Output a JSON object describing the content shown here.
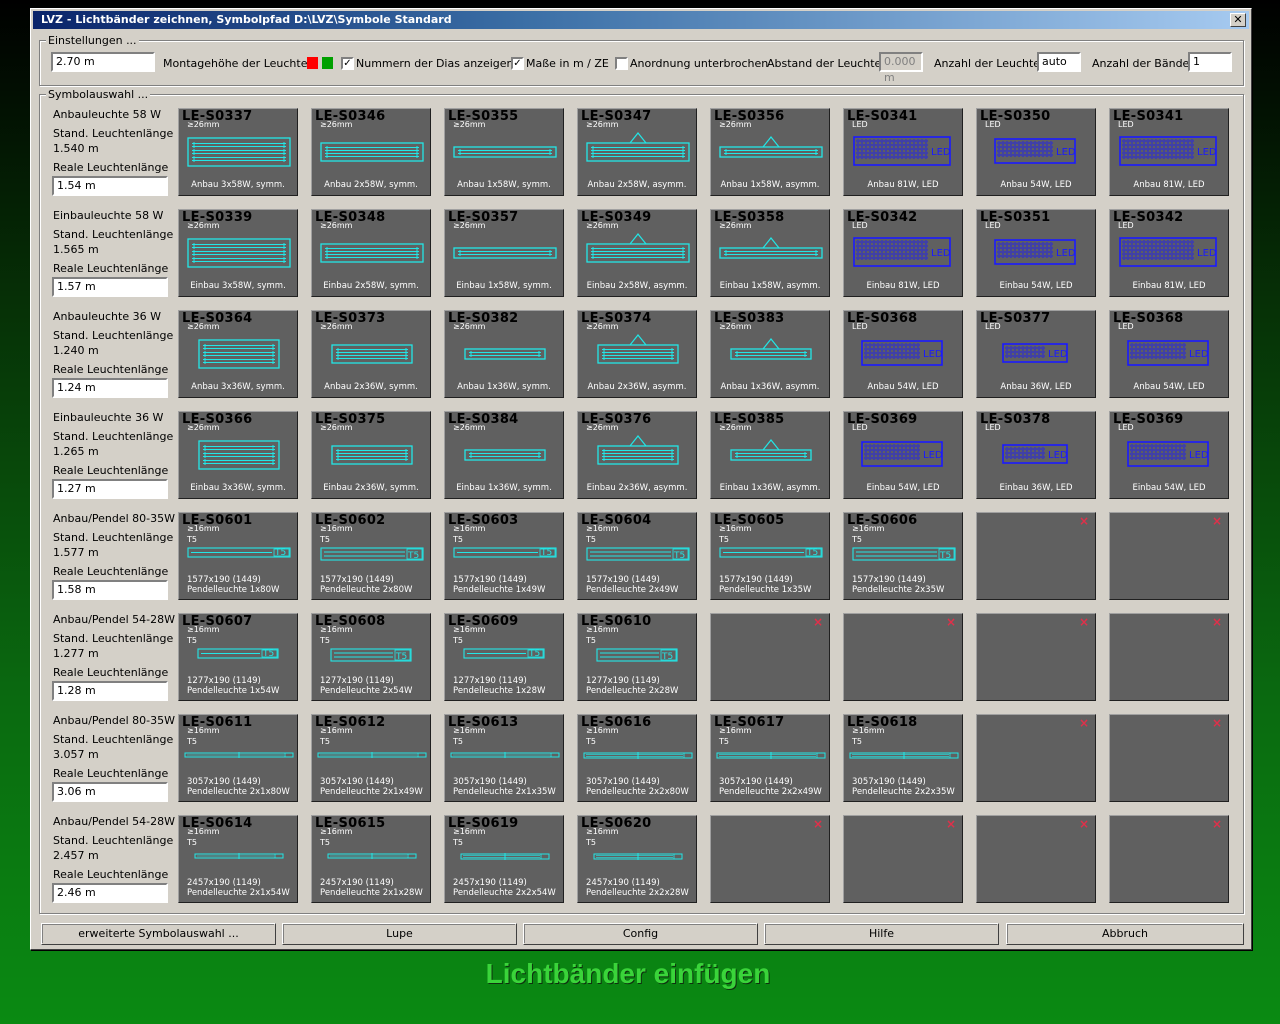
{
  "window": {
    "title": "LVZ - Lichtbänder zeichnen, Symbolpfad D:\\LVZ\\Symbole Standard",
    "close": "✕"
  },
  "settings": {
    "legend": "Einstellungen ...",
    "height_value": "2.70 m",
    "height_label": "Montagehöhe der Leuchten",
    "swatch_colors": [
      "#ff0000",
      "#00a000"
    ],
    "show_numbers_label": "Nummern der Dias anzeigen",
    "show_numbers_checked": "✓",
    "units_label": "Maße in m / ZE",
    "units_checked": "✓",
    "interrupted_label": "Anordnung unterbrochen",
    "interrupted_checked": "",
    "distance_label": "Abstand der Leuchten",
    "distance_value": "0.000 m",
    "count_label": "Anzahl der Leuchten",
    "count_value": "auto",
    "bands_label": "Anzahl der Bänder",
    "bands_value": "1"
  },
  "symbols": {
    "legend": "Symbolauswahl ...",
    "rows": [
      {
        "type": "Anbauleuchte 58 W",
        "std_label": "Stand. Leuchtenlänge",
        "std": "1.540 m",
        "real_label": "Reale Leuchtenlänge",
        "real": "1.54 m",
        "tiles": [
          {
            "code": "LE-S0337",
            "kind": "box",
            "lines": 3,
            "tri": false,
            "sub1": "≥26mm",
            "cap": "Anbau 3x58W, symm."
          },
          {
            "code": "LE-S0346",
            "kind": "box",
            "lines": 2,
            "tri": false,
            "sub1": "≥26mm",
            "cap": "Anbau 2x58W, symm."
          },
          {
            "code": "LE-S0355",
            "kind": "box",
            "lines": 1,
            "tri": false,
            "sub1": "≥26mm",
            "cap": "Anbau 1x58W, symm."
          },
          {
            "code": "LE-S0347",
            "kind": "box",
            "lines": 2,
            "tri": true,
            "sub1": "≥26mm",
            "cap": "Anbau 2x58W, asymm."
          },
          {
            "code": "LE-S0356",
            "kind": "box",
            "lines": 1,
            "tri": true,
            "sub1": "≥26mm",
            "cap": "Anbau 1x58W, asymm."
          },
          {
            "code": "LE-S0341",
            "kind": "led",
            "size": "l",
            "sub1": "LED",
            "cap": "Anbau 81W, LED"
          },
          {
            "code": "LE-S0350",
            "kind": "led",
            "size": "m",
            "sub1": "LED",
            "cap": "Anbau 54W, LED"
          },
          {
            "code": "LE-S0341",
            "kind": "led",
            "size": "l",
            "sub1": "LED",
            "cap": "Anbau 81W, LED"
          }
        ]
      },
      {
        "type": "Einbauleuchte 58 W",
        "std_label": "Stand. Leuchtenlänge",
        "std": "1.565 m",
        "real_label": "Reale Leuchtenlänge",
        "real": "1.57 m",
        "tiles": [
          {
            "code": "LE-S0339",
            "kind": "box",
            "lines": 3,
            "tri": false,
            "sub1": "≥26mm",
            "cap": "Einbau 3x58W, symm."
          },
          {
            "code": "LE-S0348",
            "kind": "box",
            "lines": 2,
            "tri": false,
            "sub1": "≥26mm",
            "cap": "Einbau 2x58W, symm."
          },
          {
            "code": "LE-S0357",
            "kind": "box",
            "lines": 1,
            "tri": false,
            "sub1": "≥26mm",
            "cap": "Einbau 1x58W, symm."
          },
          {
            "code": "LE-S0349",
            "kind": "box",
            "lines": 2,
            "tri": true,
            "sub1": "≥26mm",
            "cap": "Einbau 2x58W, asymm."
          },
          {
            "code": "LE-S0358",
            "kind": "box",
            "lines": 1,
            "tri": true,
            "sub1": "≥26mm",
            "cap": "Einbau 1x58W, asymm."
          },
          {
            "code": "LE-S0342",
            "kind": "led",
            "size": "l",
            "sub1": "LED",
            "cap": "Einbau 81W, LED"
          },
          {
            "code": "LE-S0351",
            "kind": "led",
            "size": "m",
            "sub1": "LED",
            "cap": "Einbau 54W, LED"
          },
          {
            "code": "LE-S0342",
            "kind": "led",
            "size": "l",
            "sub1": "LED",
            "cap": "Einbau 81W, LED"
          }
        ]
      },
      {
        "type": "Anbauleuchte 36 W",
        "std_label": "Stand. Leuchtenlänge",
        "std": "1.240 m",
        "real_label": "Reale Leuchtenlänge",
        "real": "1.24 m",
        "tiles": [
          {
            "code": "LE-S0364",
            "kind": "box",
            "lines": 3,
            "tri": false,
            "short": true,
            "sub1": "≥26mm",
            "cap": "Anbau 3x36W, symm."
          },
          {
            "code": "LE-S0373",
            "kind": "box",
            "lines": 2,
            "tri": false,
            "short": true,
            "sub1": "≥26mm",
            "cap": "Anbau 2x36W, symm."
          },
          {
            "code": "LE-S0382",
            "kind": "box",
            "lines": 1,
            "tri": false,
            "short": true,
            "sub1": "≥26mm",
            "cap": "Anbau 1x36W, symm."
          },
          {
            "code": "LE-S0374",
            "kind": "box",
            "lines": 2,
            "tri": true,
            "short": true,
            "sub1": "≥26mm",
            "cap": "Anbau 2x36W, asymm."
          },
          {
            "code": "LE-S0383",
            "kind": "box",
            "lines": 1,
            "tri": true,
            "short": true,
            "sub1": "≥26mm",
            "cap": "Anbau 1x36W, asymm."
          },
          {
            "code": "LE-S0368",
            "kind": "led",
            "size": "m",
            "sub1": "LED",
            "cap": "Anbau 54W, LED"
          },
          {
            "code": "LE-S0377",
            "kind": "led",
            "size": "s",
            "sub1": "LED",
            "cap": "Anbau 36W, LED"
          },
          {
            "code": "LE-S0368",
            "kind": "led",
            "size": "m",
            "sub1": "LED",
            "cap": "Anbau 54W, LED"
          }
        ]
      },
      {
        "type": "Einbauleuchte 36 W",
        "std_label": "Stand. Leuchtenlänge",
        "std": "1.265 m",
        "real_label": "Reale Leuchtenlänge",
        "real": "1.27 m",
        "tiles": [
          {
            "code": "LE-S0366",
            "kind": "box",
            "lines": 3,
            "tri": false,
            "short": true,
            "sub1": "≥26mm",
            "cap": "Einbau 3x36W, symm."
          },
          {
            "code": "LE-S0375",
            "kind": "box",
            "lines": 2,
            "tri": false,
            "short": true,
            "sub1": "≥26mm",
            "cap": "Einbau 2x36W, symm."
          },
          {
            "code": "LE-S0384",
            "kind": "box",
            "lines": 1,
            "tri": false,
            "short": true,
            "sub1": "≥26mm",
            "cap": "Einbau 1x36W, symm."
          },
          {
            "code": "LE-S0376",
            "kind": "box",
            "lines": 2,
            "tri": true,
            "short": true,
            "sub1": "≥26mm",
            "cap": "Einbau 2x36W, asymm."
          },
          {
            "code": "LE-S0385",
            "kind": "box",
            "lines": 1,
            "tri": true,
            "short": true,
            "sub1": "≥26mm",
            "cap": "Einbau 1x36W, asymm."
          },
          {
            "code": "LE-S0369",
            "kind": "led",
            "size": "m",
            "sub1": "LED",
            "cap": "Einbau 54W, LED"
          },
          {
            "code": "LE-S0378",
            "kind": "led",
            "size": "s",
            "sub1": "LED",
            "cap": "Einbau 36W, LED"
          },
          {
            "code": "LE-S0369",
            "kind": "led",
            "size": "m",
            "sub1": "LED",
            "cap": "Einbau 54W, LED"
          }
        ]
      },
      {
        "type": "Anbau/Pendel 80-35W",
        "std_label": "Stand. Leuchtenlänge",
        "std": "1.577 m",
        "real_label": "Reale Leuchtenlänge",
        "real": "1.58 m",
        "tiles": [
          {
            "code": "LE-S0601",
            "kind": "t5",
            "lines": 1,
            "len": "l",
            "sub1": "≥16mm",
            "sub2": "T5",
            "dims": "1577x190 (1449)",
            "desc": "Pendelleuchte 1x80W"
          },
          {
            "code": "LE-S0602",
            "kind": "t5",
            "lines": 2,
            "len": "l",
            "sub1": "≥16mm",
            "sub2": "T5",
            "dims": "1577x190 (1449)",
            "desc": "Pendelleuchte 2x80W"
          },
          {
            "code": "LE-S0603",
            "kind": "t5",
            "lines": 1,
            "len": "l",
            "sub1": "≥16mm",
            "sub2": "T5",
            "dims": "1577x190 (1449)",
            "desc": "Pendelleuchte 1x49W"
          },
          {
            "code": "LE-S0604",
            "kind": "t5",
            "lines": 2,
            "len": "l",
            "sub1": "≥16mm",
            "sub2": "T5",
            "dims": "1577x190 (1449)",
            "desc": "Pendelleuchte 2x49W"
          },
          {
            "code": "LE-S0605",
            "kind": "t5",
            "lines": 1,
            "len": "l",
            "sub1": "≥16mm",
            "sub2": "T5",
            "dims": "1577x190 (1449)",
            "desc": "Pendelleuchte 1x35W"
          },
          {
            "code": "LE-S0606",
            "kind": "t5",
            "lines": 2,
            "len": "l",
            "sub1": "≥16mm",
            "sub2": "T5",
            "dims": "1577x190 (1449)",
            "desc": "Pendelleuchte 2x35W"
          },
          {
            "kind": "empty",
            "mark": "x"
          },
          {
            "kind": "empty",
            "mark": "x"
          }
        ]
      },
      {
        "type": "Anbau/Pendel 54-28W",
        "std_label": "Stand. Leuchtenlänge",
        "std": "1.277 m",
        "real_label": "Reale Leuchtenlänge",
        "real": "1.28 m",
        "tiles": [
          {
            "code": "LE-S0607",
            "kind": "t5",
            "lines": 1,
            "len": "m",
            "sub1": "≥16mm",
            "sub2": "T5",
            "dims": "1277x190 (1149)",
            "desc": "Pendelleuchte 1x54W"
          },
          {
            "code": "LE-S0608",
            "kind": "t5",
            "lines": 2,
            "len": "m",
            "sub1": "≥16mm",
            "sub2": "T5",
            "dims": "1277x190 (1149)",
            "desc": "Pendelleuchte 2x54W"
          },
          {
            "code": "LE-S0609",
            "kind": "t5",
            "lines": 1,
            "len": "m",
            "sub1": "≥16mm",
            "sub2": "T5",
            "dims": "1277x190 (1149)",
            "desc": "Pendelleuchte 1x28W"
          },
          {
            "code": "LE-S0610",
            "kind": "t5",
            "lines": 2,
            "len": "m",
            "sub1": "≥16mm",
            "sub2": "T5",
            "dims": "1277x190 (1149)",
            "desc": "Pendelleuchte 2x28W"
          },
          {
            "kind": "empty",
            "mark": "x"
          },
          {
            "kind": "empty",
            "mark": "x"
          },
          {
            "kind": "empty",
            "mark": "x"
          },
          {
            "kind": "empty",
            "mark": "x"
          }
        ]
      },
      {
        "type": "Anbau/Pendel 80-35W",
        "std_label": "Stand. Leuchtenlänge",
        "std": "3.057 m",
        "real_label": "Reale Leuchtenlänge",
        "real": "3.06 m",
        "tiles": [
          {
            "code": "LE-S0611",
            "kind": "band",
            "lines": 1,
            "len": "xl",
            "sub1": "≥16mm",
            "sub2": "T5",
            "dims": "3057x190 (1449)",
            "desc": "Pendelleuchte 2x1x80W"
          },
          {
            "code": "LE-S0612",
            "kind": "band",
            "lines": 1,
            "len": "xl",
            "sub1": "≥16mm",
            "sub2": "T5",
            "dims": "3057x190 (1449)",
            "desc": "Pendelleuchte 2x1x49W"
          },
          {
            "code": "LE-S0613",
            "kind": "band",
            "lines": 1,
            "len": "xl",
            "sub1": "≥16mm",
            "sub2": "T5",
            "dims": "3057x190 (1449)",
            "desc": "Pendelleuchte 2x1x35W"
          },
          {
            "code": "LE-S0616",
            "kind": "band",
            "lines": 2,
            "len": "xl",
            "sub1": "≥16mm",
            "sub2": "T5",
            "dims": "3057x190 (1449)",
            "desc": "Pendelleuchte 2x2x80W"
          },
          {
            "code": "LE-S0617",
            "kind": "band",
            "lines": 2,
            "len": "xl",
            "sub1": "≥16mm",
            "sub2": "T5",
            "dims": "3057x190 (1449)",
            "desc": "Pendelleuchte 2x2x49W"
          },
          {
            "code": "LE-S0618",
            "kind": "band",
            "lines": 2,
            "len": "xl",
            "sub1": "≥16mm",
            "sub2": "T5",
            "dims": "3057x190 (1449)",
            "desc": "Pendelleuchte 2x2x35W"
          },
          {
            "kind": "empty",
            "mark": "x"
          },
          {
            "kind": "empty",
            "mark": "x"
          }
        ]
      },
      {
        "type": "Anbau/Pendel 54-28W",
        "std_label": "Stand. Leuchtenlänge",
        "std": "2.457 m",
        "real_label": "Reale Leuchtenlänge",
        "real": "2.46 m",
        "tiles": [
          {
            "code": "LE-S0614",
            "kind": "band",
            "lines": 1,
            "len": "lg",
            "sub1": "≥16mm",
            "sub2": "T5",
            "dims": "2457x190 (1149)",
            "desc": "Pendelleuchte 2x1x54W"
          },
          {
            "code": "LE-S0615",
            "kind": "band",
            "lines": 1,
            "len": "lg",
            "sub1": "≥16mm",
            "sub2": "T5",
            "dims": "2457x190 (1149)",
            "desc": "Pendelleuchte 2x1x28W"
          },
          {
            "code": "LE-S0619",
            "kind": "band",
            "lines": 2,
            "len": "lg",
            "sub1": "≥16mm",
            "sub2": "T5",
            "dims": "2457x190 (1149)",
            "desc": "Pendelleuchte 2x2x54W"
          },
          {
            "code": "LE-S0620",
            "kind": "band",
            "lines": 2,
            "len": "lg",
            "sub1": "≥16mm",
            "sub2": "T5",
            "dims": "2457x190 (1149)",
            "desc": "Pendelleuchte 2x2x28W"
          },
          {
            "kind": "empty",
            "mark": "x"
          },
          {
            "kind": "empty",
            "mark": "x"
          },
          {
            "kind": "empty",
            "mark": "x"
          },
          {
            "kind": "empty",
            "mark": "x"
          }
        ]
      }
    ]
  },
  "buttons": {
    "extended": "erweiterte Symbolauswahl ...",
    "lupe": "Lupe",
    "config": "Config",
    "help": "Hilfe",
    "cancel": "Abbruch"
  },
  "caption": "Lichtbänder einfügen",
  "colors": {
    "cyan": "#22e6e6",
    "led_blue": "#1a1aff",
    "tile_bg": "#606060",
    "x_mark": "#e0304a"
  }
}
